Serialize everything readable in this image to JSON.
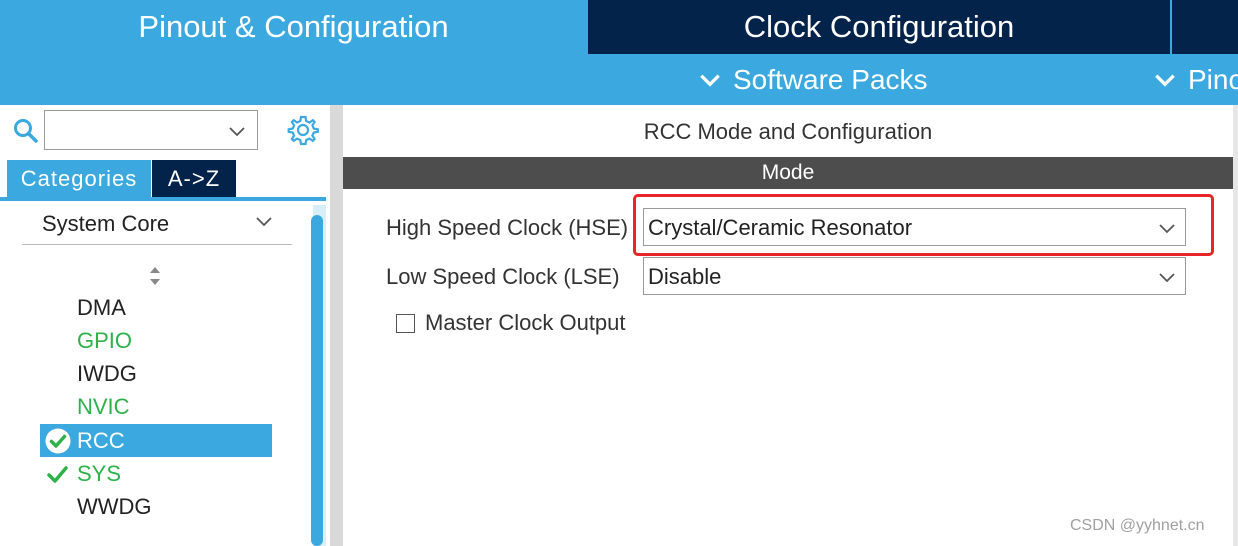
{
  "tabs": {
    "pinout": "Pinout & Configuration",
    "clock": "Clock Configuration"
  },
  "subbar": {
    "software_packs": "Software Packs",
    "pinout_partial": "Pino"
  },
  "left_panel": {
    "categories_tab": "Categories",
    "az_tab": "A->Z",
    "category_selected": "System Core",
    "items": [
      {
        "label": "DMA",
        "status": "none"
      },
      {
        "label": "GPIO",
        "status": "configured-green"
      },
      {
        "label": "IWDG",
        "status": "none"
      },
      {
        "label": "NVIC",
        "status": "configured-green"
      },
      {
        "label": "RCC",
        "status": "selected-check"
      },
      {
        "label": "SYS",
        "status": "check-green"
      },
      {
        "label": "WWDG",
        "status": "none"
      }
    ]
  },
  "right_panel": {
    "title": "RCC Mode and Configuration",
    "mode_header": "Mode",
    "hse_label": "High Speed Clock (HSE)",
    "hse_value": "Crystal/Ceramic Resonator",
    "lse_label": "Low Speed Clock (LSE)",
    "lse_value": "Disable",
    "mco_label": "Master Clock Output",
    "mco_checked": false
  },
  "colors": {
    "accent": "#3ba9df",
    "dark": "#03234b",
    "highlight": "#e8262a",
    "green": "#2fb14a"
  },
  "watermark": "CSDN @yyhnet.cn"
}
